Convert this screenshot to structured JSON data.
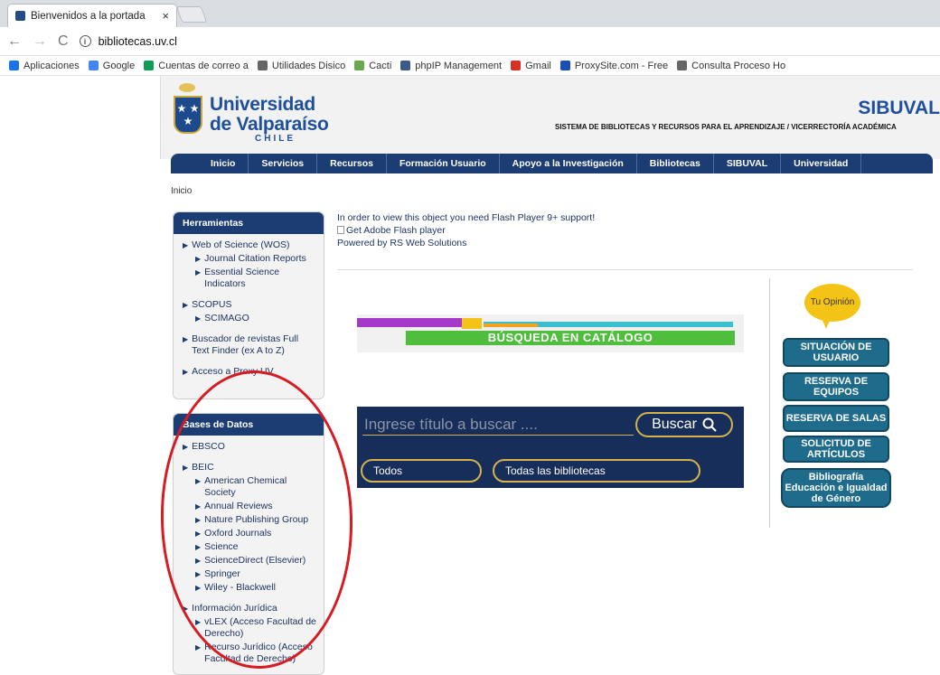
{
  "browser": {
    "tab_title": "Bienvenidos a la portada",
    "tab_close": "×",
    "url": "bibliotecas.uv.cl",
    "bookmarks": [
      {
        "label": "Aplicaciones",
        "icon": "apps-grid-icon",
        "color": "#1a73e8"
      },
      {
        "label": "Google",
        "icon": "google-icon",
        "color": "#4285f4"
      },
      {
        "label": "Cuentas de correo a",
        "icon": "sheet-icon",
        "color": "#0f9d58"
      },
      {
        "label": "Utilidades Disico",
        "icon": "page-icon",
        "color": "#666666"
      },
      {
        "label": "Cacti",
        "icon": "cacti-icon",
        "color": "#6aa84f"
      },
      {
        "label": "phpIP Management",
        "icon": "phpip-icon",
        "color": "#3d5a8a"
      },
      {
        "label": "Gmail",
        "icon": "gmail-icon",
        "color": "#d93025"
      },
      {
        "label": "ProxySite.com - Free",
        "icon": "shield-icon",
        "color": "#1a4fb5"
      },
      {
        "label": "Consulta Proceso Ho",
        "icon": "page-icon",
        "color": "#666666"
      }
    ]
  },
  "header": {
    "logo_line1": "Universidad",
    "logo_line2": "de Valparaíso",
    "logo_line3": "CHILE",
    "site_title": "SIBUVAL",
    "site_subtitle": "SISTEMA DE BIBLIOTECAS Y RECURSOS PARA EL APRENDIZAJE / VICERRECTORÍA ACADÉMICA"
  },
  "nav": [
    "Inicio",
    "Servicios",
    "Recursos",
    "Formación Usuario",
    "Apoyo a la Investigación",
    "Bibliotecas",
    "SIBUVAL",
    "Universidad"
  ],
  "breadcrumb": "Inicio",
  "herramientas": {
    "title": "Herramientas",
    "items": [
      {
        "label": "Web of Science (WOS)",
        "level": 0
      },
      {
        "label": "Journal Citation Reports",
        "level": 1
      },
      {
        "label": "Essential Science Indicators",
        "level": 1
      },
      {
        "label": "SCOPUS",
        "level": 0
      },
      {
        "label": "SCIMAGO",
        "level": 1
      },
      {
        "label": "Buscador de revistas Full Text Finder (ex A to Z)",
        "level": 0
      },
      {
        "label": "Acceso a Proxy UV",
        "level": 0
      }
    ]
  },
  "bases": {
    "title": "Bases de Datos",
    "items": [
      {
        "label": "EBSCO",
        "level": 0
      },
      {
        "label": "BEIC",
        "level": 0
      },
      {
        "label": "American Chemical Society",
        "level": 1
      },
      {
        "label": "Annual Reviews",
        "level": 1
      },
      {
        "label": "Nature Publishing Group",
        "level": 1
      },
      {
        "label": "Oxford Journals",
        "level": 1
      },
      {
        "label": "Science",
        "level": 1
      },
      {
        "label": "ScienceDirect (Elsevier)",
        "level": 1
      },
      {
        "label": "Springer",
        "level": 1
      },
      {
        "label": "Wiley - Blackwell",
        "level": 1
      },
      {
        "label": "Información Jurídica",
        "level": 0
      },
      {
        "label": "vLEX (Acceso Facultad de Derecho)",
        "level": 1
      },
      {
        "label": "Recurso Jurídico (Acceso Facultad de Derecho)",
        "level": 1
      }
    ]
  },
  "flash": {
    "line1": "In order to view this object you need Flash Player 9+ support!",
    "line2": "Get Adobe Flash player",
    "line3": "Powered by RS Web Solutions"
  },
  "catalog_banner": "BÚSQUEDA EN CATÁLOGO",
  "search": {
    "placeholder": "Ingrese título a buscar ....",
    "button": "Buscar",
    "filter1": "Todos",
    "filter2": "Todas las bibliotecas"
  },
  "right": {
    "opinion": "Tu Opinión",
    "buttons": [
      "SITUACIÓN DE USUARIO",
      "RESERVA DE EQUIPOS",
      "RESERVA DE SALAS",
      "SOLICITUD DE ARTÍCULOS",
      "Bibliografía Educación e Igualdad de Género"
    ]
  }
}
